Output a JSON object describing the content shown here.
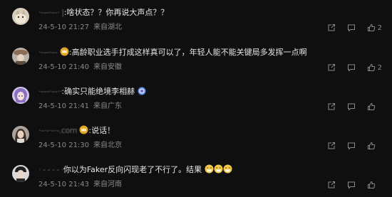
{
  "colors": {
    "background": "#0f0f10",
    "text": "#e6e6e6",
    "meta": "#8a8a8a",
    "icon": "#8a8a8a",
    "name_blur": "#6e6e6e"
  },
  "comments": [
    {
      "name": "·-–-·–-· |",
      "text": "啥状态？？你再说大声点？？",
      "time": "24-5-10 21:27",
      "location": "来自湖北",
      "likes": "2",
      "avatar": "avatar-cat"
    },
    {
      "name": "·-–-·–-",
      "text": "高龄职业选手打成这样真可以了，年轻人能不能关键局多发挥一点啊",
      "time": "24-5-10 21:40",
      "location": "来自安徽",
      "likes": "2",
      "avatar": "avatar-girl-hat"
    },
    {
      "name": "·-–-·–-··",
      "text": "确实只能绝境李相赫",
      "time": "24-5-10 21:41",
      "location": "来自广东",
      "likes": "",
      "avatar": "avatar-anime"
    },
    {
      "name": "·–·-·–·-.com",
      "text": "说话！",
      "time": "24-5-10 21:30",
      "location": "来自北京",
      "likes": "",
      "avatar": "avatar-woman"
    },
    {
      "name": "· - - - - ·",
      "text": "你以为Faker反向闪现老了不行了。结果",
      "time": "24-5-10 21:43",
      "location": "来自河南",
      "likes": "",
      "avatar": "avatar-man"
    }
  ]
}
